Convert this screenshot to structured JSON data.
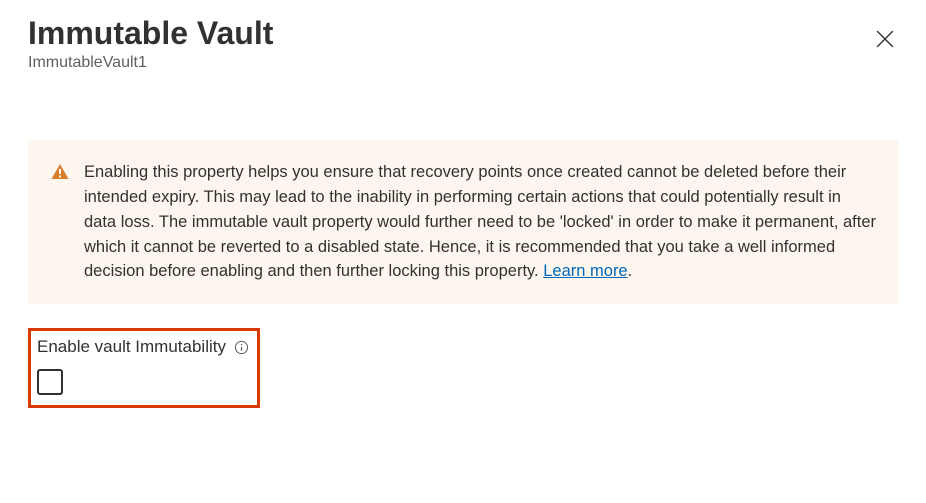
{
  "header": {
    "title": "Immutable Vault",
    "subtitle": "ImmutableVault1"
  },
  "infobox": {
    "message": "Enabling this property helps you ensure that recovery points once created cannot be deleted before their intended expiry. This may lead to the inability in performing certain actions that could potentially result in data loss. The immutable vault property would further need to be 'locked' in order to make it permanent, after which it cannot be reverted to a disabled state. Hence, it is recommended that you take a well informed decision before enabling and then further locking this property. ",
    "learn_more": "Learn more"
  },
  "enable": {
    "label": "Enable vault Immutability"
  }
}
